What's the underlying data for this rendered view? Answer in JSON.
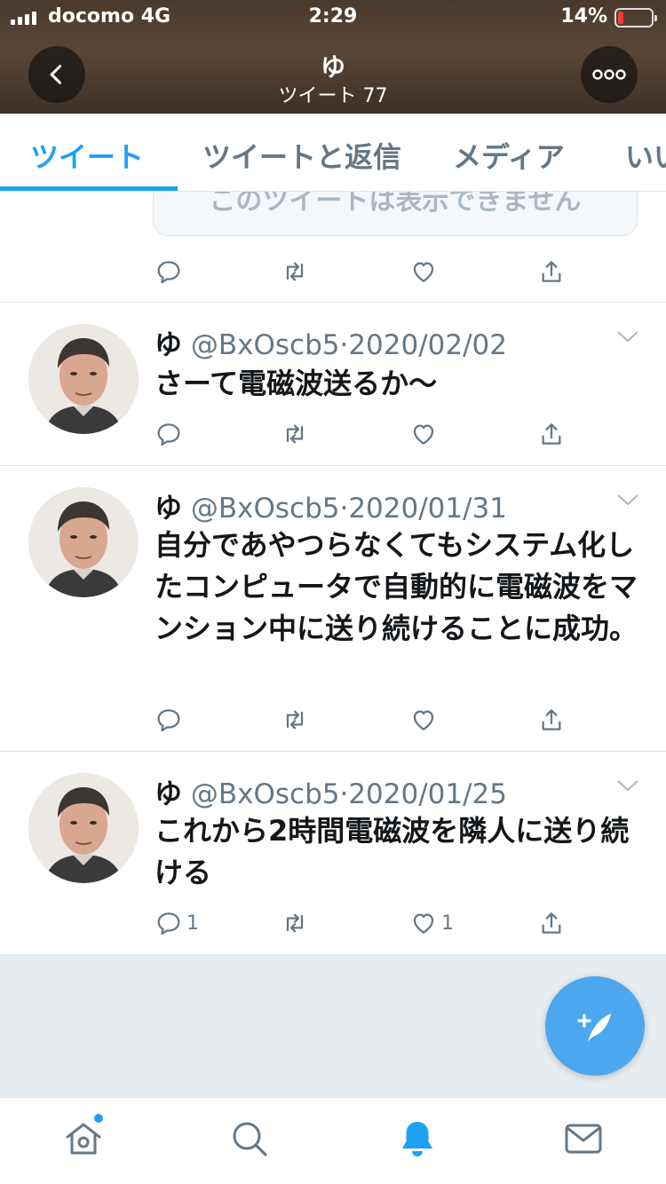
{
  "status_bar": {
    "carrier": "docomo",
    "network": "4G",
    "time": "2:29",
    "battery_percent": "14%",
    "battery_level": 0.14
  },
  "profile": {
    "name": "ゆ",
    "tweet_count_label": "ツイート 77"
  },
  "tabs": [
    {
      "label": "ツイート",
      "active": true
    },
    {
      "label": "ツイートと返信",
      "active": false
    },
    {
      "label": "メディア",
      "active": false
    },
    {
      "label": "いい",
      "active": false
    }
  ],
  "hidden_tweet": {
    "text": "このツイートは表示できません"
  },
  "tweets": [
    {
      "name": "ゆ",
      "handle": "@BxOscb5",
      "date": "2020/02/02",
      "text": "さーて電磁波送るか〜",
      "reply_count": "",
      "like_count": ""
    },
    {
      "name": "ゆ",
      "handle": "@BxOscb5",
      "date": "2020/01/31",
      "text": "自分であやつらなくてもシステム化したコンピュータで自動的に電磁波をマンション中に送り続けることに成功。",
      "reply_count": "",
      "like_count": ""
    },
    {
      "name": "ゆ",
      "handle": "@BxOscb5",
      "date": "2020/01/25",
      "text": "これから2時間電磁波を隣人に送り続ける",
      "reply_count": "1",
      "like_count": "1"
    }
  ],
  "colors": {
    "accent": "#1da1f2",
    "fab": "#4ca7ee",
    "muted": "#657786",
    "header_bg": "#4a3a2c"
  },
  "icons": {
    "back": "chevron-left-icon",
    "more": "more-icon",
    "reply": "reply-icon",
    "retweet": "retweet-icon",
    "like": "heart-icon",
    "share": "share-icon",
    "compose": "compose-icon",
    "home": "home-icon",
    "search": "search-icon",
    "notifications": "bell-icon",
    "messages": "mail-icon"
  }
}
